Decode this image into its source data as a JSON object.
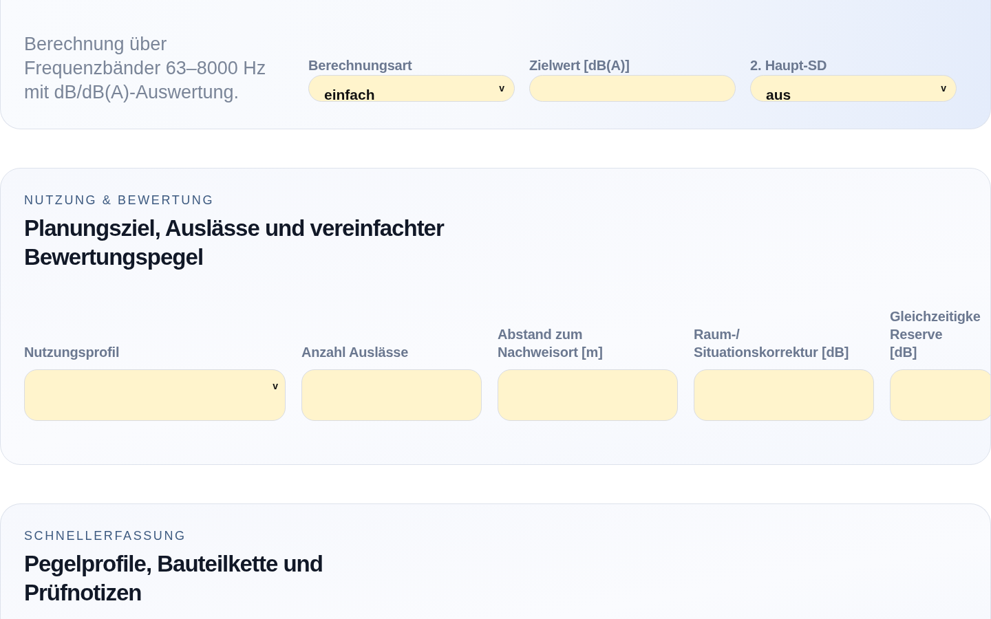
{
  "intro": {
    "description": "Berechnung über Frequenzbänder 63–8000 Hz mit dB/dB(A)-Auswertung.",
    "fields": [
      {
        "label": "Berechnungsart",
        "value": "einfach",
        "chevron": "v"
      },
      {
        "label": "Zielwert [dB(A)]"
      },
      {
        "label": "2. Haupt-SD",
        "value": "aus",
        "chevron": "v"
      }
    ]
  },
  "sections": [
    {
      "eyebrow": "NUTZUNG & BEWERTUNG",
      "title": "Planungsziel, Auslässe und vereinfachter Bewertungspegel",
      "fields": [
        {
          "label": "Nutzungsprofil",
          "chevron": "v"
        },
        {
          "label": "Anzahl Auslässe"
        },
        {
          "label": "Abstand zum Nachweisort [m]"
        },
        {
          "label": "Raum-/ Situationskorrektur [dB]"
        },
        {
          "label": "Gleichzeitigke Reserve [dB]"
        }
      ]
    },
    {
      "eyebrow": "SCHNELLERFASSUNG",
      "title": "Pegelprofile, Bauteilkette und Prüfnotizen"
    }
  ]
}
